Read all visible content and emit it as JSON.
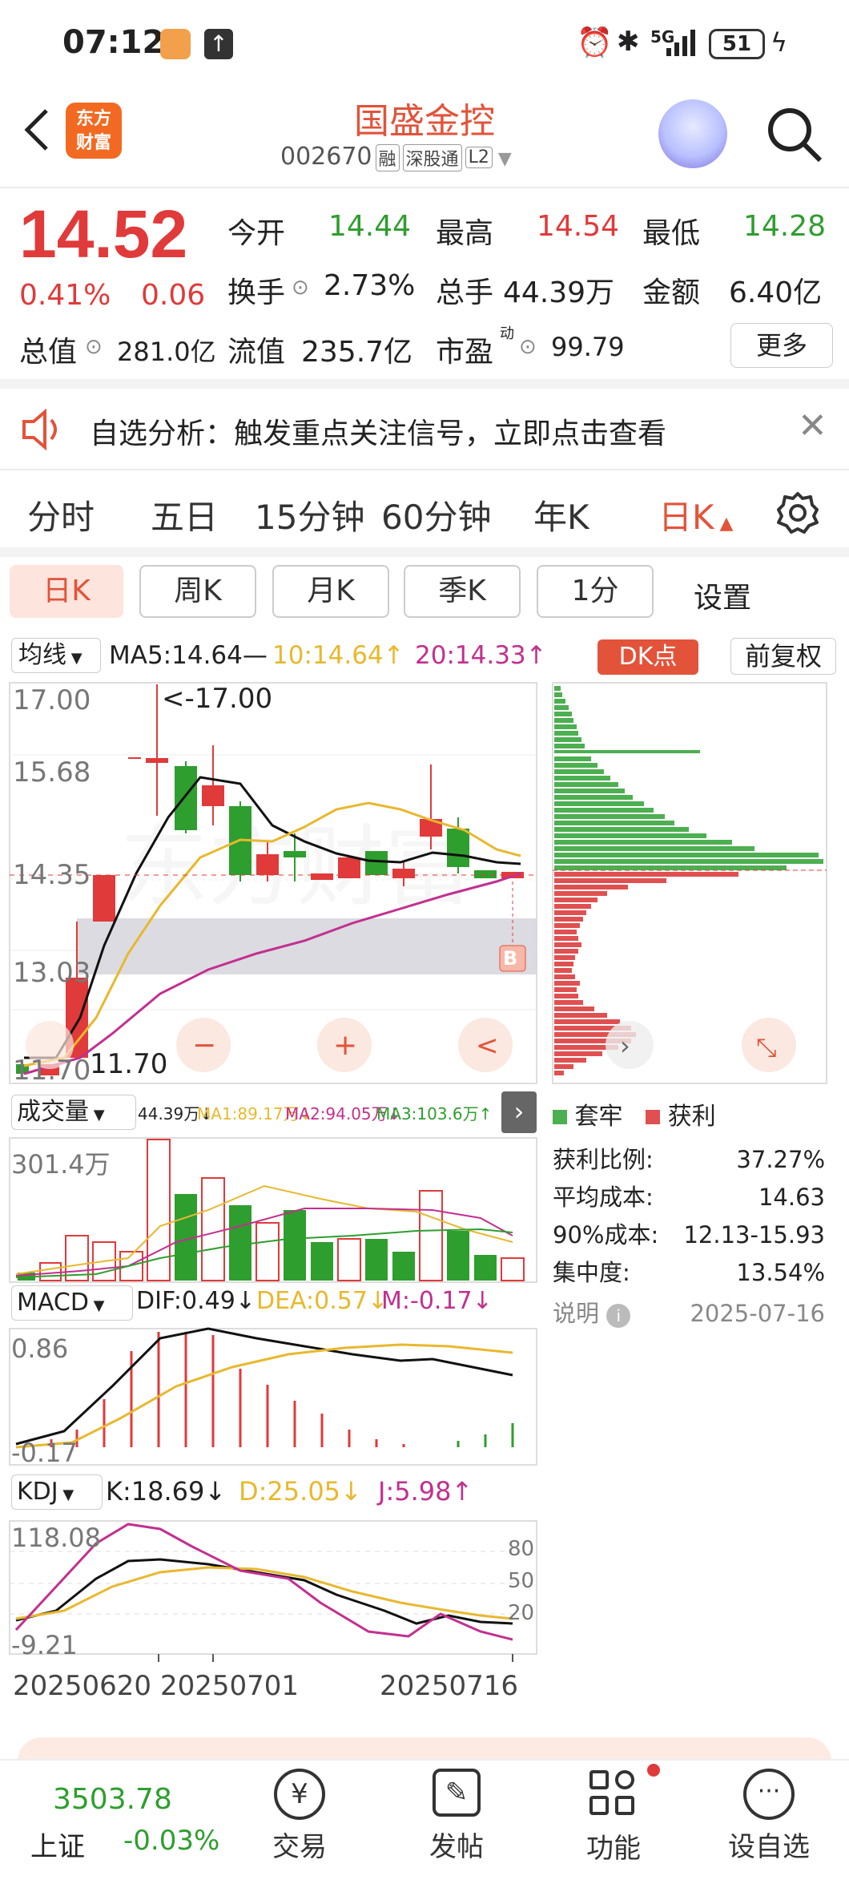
{
  "status": {
    "time": "07:12",
    "network": "5G",
    "battery": "51"
  },
  "header": {
    "logo_line1": "东方",
    "logo_line2": "财富",
    "name": "国盛金控",
    "code": "002670",
    "tags": [
      "融",
      "深股通",
      "L2"
    ]
  },
  "quote": {
    "price": "14.52",
    "change_pct": "0.41%",
    "change": "0.06",
    "open_label": "今开",
    "open": "14.44",
    "high_label": "最高",
    "high": "14.54",
    "low_label": "最低",
    "low": "14.28",
    "turnover_label": "换手",
    "turnover": "2.73%",
    "volume_label": "总手",
    "volume": "44.39万",
    "amount_label": "金额",
    "amount": "6.40亿",
    "mcap_label": "总值",
    "mcap": "281.0亿",
    "float_label": "流值",
    "float_cap": "235.7亿",
    "pe_label": "市盈",
    "pe_sup": "动",
    "pe": "99.79",
    "more": "更多"
  },
  "notice": {
    "text": "自选分析：触发重点关注信号，立即点击查看"
  },
  "tabs": [
    "分时",
    "五日",
    "15分钟",
    "60分钟",
    "年K",
    "日K"
  ],
  "active_tab": "日K",
  "subtabs": [
    "日K",
    "周K",
    "月K",
    "季K",
    "1分"
  ],
  "settings_label": "设置",
  "ma_bar": {
    "label": "均线",
    "ma5": "MA5:14.64—",
    "ma10": "10:14.64↑",
    "ma20": "20:14.33↑",
    "dk": "DK点",
    "adjust": "前复权"
  },
  "kline_axis": {
    "y_top": "17.00",
    "y2": "15.68",
    "y3": "14.35",
    "y4": "13.03",
    "y_bottom": "11.70",
    "high_note": "<-17.00",
    "low_note": "11.70",
    "b_mark": "B"
  },
  "chip": {
    "legend_trap": "套牢",
    "legend_profit": "获利",
    "rows": [
      {
        "k": "获利比例:",
        "v": "37.27%"
      },
      {
        "k": "平均成本:",
        "v": "14.63"
      },
      {
        "k": "90%成本:",
        "v": "12.13-15.93"
      },
      {
        "k": "集中度:",
        "v": "13.54%"
      }
    ],
    "explain": "说明",
    "date": "2025-07-16"
  },
  "volume": {
    "label": "成交量",
    "stats": "44.39万↓",
    "ma1": "MA1:89.17万↓",
    "ma2": "MA2:94.05万↓",
    "ma3": "MA3:103.6万↑",
    "y_top": "301.4万"
  },
  "macd": {
    "label": "MACD",
    "dif": "DIF:0.49↓",
    "dea": "DEA:0.57↓",
    "m": "M:-0.17↓",
    "y_top": "0.86",
    "y_bottom": "-0.17"
  },
  "kdj": {
    "label": "KDJ",
    "k": "K:18.69↓",
    "d": "D:25.05↓",
    "j": "J:5.98↑",
    "y_top": "118.08",
    "y_bottom": "-9.21",
    "lv80": "80",
    "lv50": "50",
    "lv20": "20"
  },
  "dates": {
    "d1": "20250620",
    "d2": "20250701",
    "d3": "20250716"
  },
  "bottom_nav": {
    "index_value": "3503.78",
    "index_name": "上证",
    "index_change": "-0.03%",
    "trade": "交易",
    "post": "发帖",
    "func": "功能",
    "watch": "设自选"
  },
  "colors": {
    "up": "#e03a3a",
    "down": "#2e9e2e",
    "accent": "#e2533a",
    "ma5": "#000000",
    "ma10": "#e8b82e",
    "ma20": "#c2308f"
  }
}
